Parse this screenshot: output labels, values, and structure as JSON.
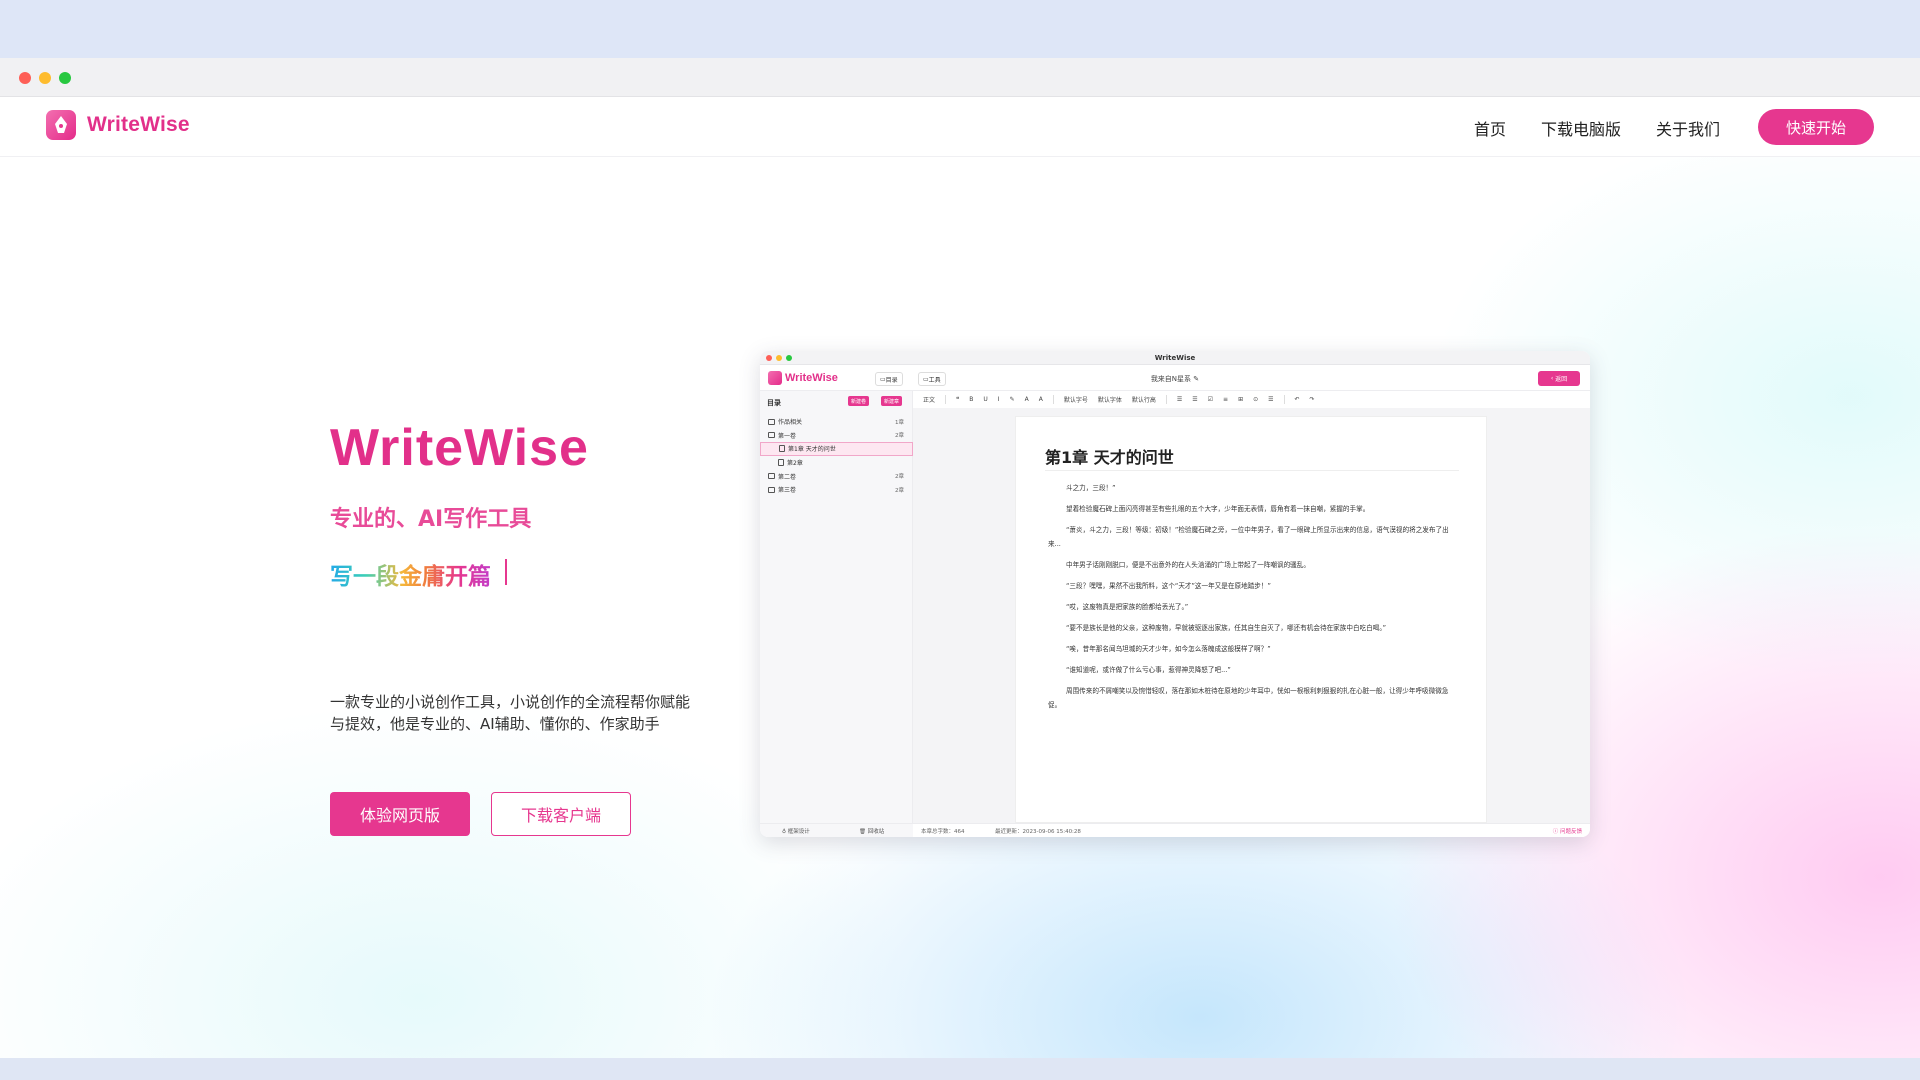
{
  "nav": {
    "brand": "WriteWise",
    "links": [
      "首页",
      "下载电脑版",
      "关于我们"
    ],
    "cta": "快速开始"
  },
  "hero": {
    "title": "WriteWise",
    "subtitle": "专业的、AI写作工具",
    "typed_text": "写一段金庸开篇",
    "description": "一款专业的小说创作工具，小说创作的全流程帮你赋能与提效，他是专业的、AI辅助、懂你的、作家助手",
    "primary_button": "体验网页版",
    "secondary_button": "下载客户端"
  },
  "app_preview": {
    "window_title": "WriteWise",
    "brand": "WriteWise",
    "header_buttons": [
      "目录",
      "工具"
    ],
    "doc_title": "我来自N星系",
    "back_button": "返回",
    "sidebar": {
      "heading": "目录",
      "buttons": [
        "新建卷",
        "新建章"
      ],
      "tree": [
        {
          "label": "作品相关",
          "count": "1章",
          "level": 0,
          "type": "folder",
          "active": false
        },
        {
          "label": "第一卷",
          "count": "2章",
          "level": 0,
          "type": "folder",
          "active": false
        },
        {
          "label": "第1章 天才的问世",
          "count": "",
          "level": 1,
          "type": "file",
          "active": true
        },
        {
          "label": "第2章",
          "count": "",
          "level": 1,
          "type": "file",
          "active": false
        },
        {
          "label": "第二卷",
          "count": "2章",
          "level": 0,
          "type": "folder",
          "active": false
        },
        {
          "label": "第三卷",
          "count": "2章",
          "level": 0,
          "type": "folder",
          "active": false
        }
      ],
      "footer": [
        "框架设计",
        "回收站"
      ]
    },
    "toolbar": [
      "正文",
      "❝",
      "B",
      "U",
      "I",
      "✎",
      "A",
      "A",
      "默认字号",
      "默认字体",
      "默认行高",
      "☰",
      "☰",
      "☑",
      "≡",
      "⊞",
      "⊙",
      "☰",
      "↶",
      "↷"
    ],
    "chapter_title": "第1章  天才的问世",
    "paragraphs": [
      "斗之力，三段！”",
      "望着检验魔石碑上面闪亮得甚至有些扎眼的五个大字，少年面无表情，唇角有着一抹自嘲，紧握的手掌。",
      "“萧炎，斗之力，三段！等级：初级！”检验魔石碑之旁，一位中年男子，看了一眼碑上所显示出来的信息，语气漠视的将之发布了出来...",
      "中年男子话刚刚脱口，便是不出意外的在人头汹涌的广场上带起了一阵嘲讽的骚乱。",
      "“三段？嘿嘿，果然不出我所料，这个“天才”这一年又是在原地踏步！”",
      "“哎，这废物真是把家族的脸都给丢光了。”",
      "“要不是族长是他的父亲，这种废物，早就被驱逐出家族，任其自生自灭了，哪还有机会待在家族中白吃白喝。”",
      "“唉，昔年那名闻乌坦城的天才少年，如今怎么落魄成这般模样了啊？”",
      "“谁知道呢，或许做了什么亏心事，惹得神灵降怒了吧...”",
      "周围传来的不屑嘲笑以及惋惜轻叹，落在那如木桩待在原地的少年耳中，恍如一根根利刺狠狠的扎在心脏一般，让得少年呼吸微微急促。"
    ],
    "status": {
      "word_count": "本章总字数：464",
      "last_update": "最近更新：2023-09-06 15:40:28",
      "feedback": "问题反馈"
    }
  },
  "colors": {
    "brand": "#e6378f",
    "brand_dark": "#e2308a"
  }
}
